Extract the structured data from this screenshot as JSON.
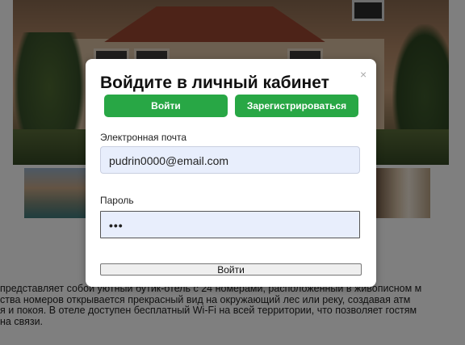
{
  "login_modal": {
    "title": "Войдите в личный кабинет",
    "close_symbol": "×",
    "tabs": {
      "login_label": "Войти",
      "register_label": "Зарегистрироваться"
    },
    "email": {
      "label": "Электронная почта",
      "value": "pudrin0000@email.com"
    },
    "password": {
      "label": "Пароль",
      "masked_value": "•••"
    },
    "submit_label": "Войти"
  },
  "background_page": {
    "description_lines": [
      "представляет собой уютный бутик-отель с 24 номерами, расположенный в живописном м",
      "ства номеров открывается прекрасный вид на окружающий лес или реку, создавая атм",
      "я и покоя. В отеле доступен бесплатный Wi-Fi на всей территории, что позволяет гостям",
      "на связи."
    ]
  },
  "colors": {
    "accent_green": "#28a745",
    "input_fill": "#e8eefc",
    "overlay": "rgba(0,0,0,0.5)"
  }
}
